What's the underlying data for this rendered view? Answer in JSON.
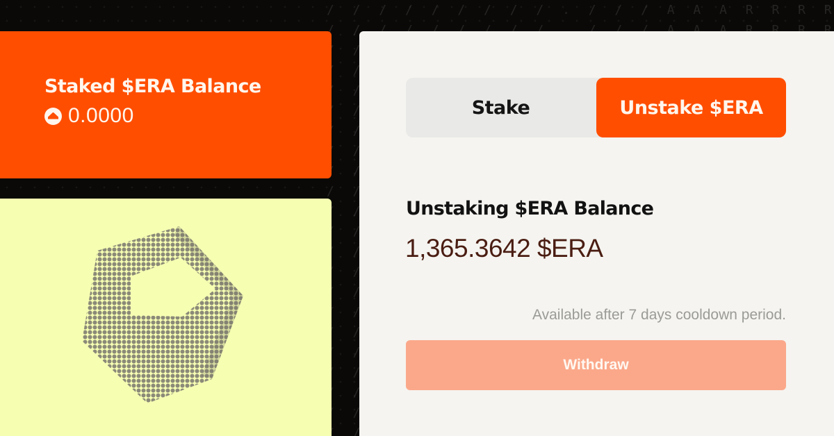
{
  "staked": {
    "title": "Staked $ERA Balance",
    "icon": "era-logo-icon",
    "value": "0.0000"
  },
  "tabs": {
    "stake_label": "Stake",
    "unstake_label": "Unstake $ERA",
    "active": "unstake"
  },
  "unstaking": {
    "title": "Unstaking $ERA Balance",
    "value": "1,365.3642 $ERA",
    "cooldown_note": "Available after 7 days cooldown period."
  },
  "withdraw_button": {
    "label": "Withdraw",
    "state": "disabled"
  },
  "background_rows": [
    "/ / / / / / / / / . / / / A A A R R R R R R R R R",
    "/ / / / / / / / / . / / / A A A R R R R R R R R R",
    "/ / / / / / / / / / / / / / / / / / / / / / / / /",
    "/ / / / / / / / / / / / / / / / / / / / / / / / /",
    "/ / / / / / / / / / / / / / / / / / / / / / / / /",
    "/ / / / / / / / / / / / / / / / / / / / / / / / /",
    "/ / / / / / / / / / / / / / / / / / / / / / / / /",
    "/ / / / / / / / / / / / / / / / / / / / / / / / /",
    "/ / / / / / / / / / / / / / / / / / / / / / / / /",
    "/ / / / / / / / / / / / / / / / / / / / / / / / /",
    "/ / / / / / / / / / / / / / / / / / / / / / / / /",
    "/ / / / / / / / / / / / / / / / / / / / / / / / /",
    "/ / / / / / / / / / / / / / / / / / / / / / / / /",
    "/ / / / / / / / / / / / / / / / / / / / / / / / /",
    "/ / / / / / / / / / / / / / / / / / / / / / / / /",
    "/ / / / / / / / / / / / / / / / / / / / / / / / /",
    "/ / / / / / / / / / / / / / / / / / / / / / / / /",
    "/ / / / / / / / / / / / / / / / / / / / / / / / /",
    "/ / / / / / / / / / / / / / / / / / / / / / / / /",
    "/ / / / / / / / / / / / / / / / / / / / / / / / /",
    "/ / / / / / / / / / / / / / / / / / / / / / / / /",
    "/ / / / / / / / / / / / / / / / / / / / / / / / /"
  ],
  "colors": {
    "accent": "#ff4e00",
    "background": "#0b0907",
    "panel": "#f5f4f0",
    "art_card": "#f6feb2",
    "value_text": "#4a1d12",
    "withdraw_disabled": "#fba88a"
  }
}
